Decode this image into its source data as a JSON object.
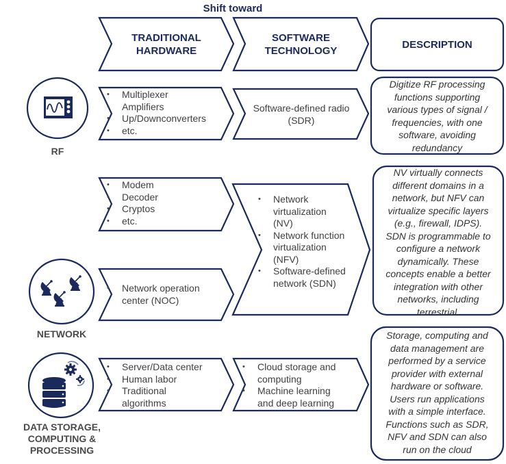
{
  "header": {
    "shift_label": "Shift toward",
    "col_hardware": [
      "TRADITIONAL",
      "HARDWARE"
    ],
    "col_software": [
      "SOFTWARE",
      "TECHNOLOGY"
    ],
    "col_description": "DESCRIPTION"
  },
  "colors": {
    "navy": "#1b2a5c",
    "text_gray": "#404040",
    "label_gray": "#4a4a4a"
  },
  "rows": {
    "rf": {
      "label": "RF",
      "icon": "signal-monitor-icon",
      "hardware": [
        "Multiplexer",
        "Amplifiers",
        "Up/Downconverters",
        "etc."
      ],
      "software": [
        "Software-defined radio",
        "(SDR)"
      ],
      "description": [
        "Digitize RF processing",
        "functions supporting",
        "various types of signal /",
        "frequencies, with one",
        "software, avoiding",
        "redundancy"
      ]
    },
    "network": {
      "label": "NETWORK",
      "icon": "satellite-dishes-icon",
      "hardware_a": [
        "Modem",
        "Decoder",
        "Cryptos",
        "etc."
      ],
      "hardware_b": [
        "Network operation center (NOC)"
      ],
      "software": [
        "Network virtualization (NV)",
        "Network function virtualization (NFV)",
        "Software-defined network (SDN)"
      ],
      "description": [
        "NV virtually connects",
        "different domains in a",
        "network, but NFV can",
        "virtualize specific layers",
        "(e.g., firewall, IDPS).",
        "SDN is programmable to",
        "configure a network",
        "dynamically. These",
        "concepts enable a better",
        "integration with other",
        "networks, including",
        "terrestrial."
      ]
    },
    "data": {
      "label": [
        "DATA STORAGE,",
        "COMPUTING &",
        "PROCESSING"
      ],
      "icon": "database-gears-icon",
      "hardware": [
        "Server/Data center",
        "Human labor",
        "Traditional algorithms"
      ],
      "software": [
        "Cloud storage and computing",
        "Machine learning and deep learning"
      ],
      "description": [
        "Storage, computing and",
        "data management are",
        "performed by a service",
        "provider with external",
        "hardware or software.",
        "Users run applications",
        "with a simple interface.",
        "Functions such as SDR,",
        "NFV and SDN can also",
        "run on the cloud"
      ]
    }
  }
}
